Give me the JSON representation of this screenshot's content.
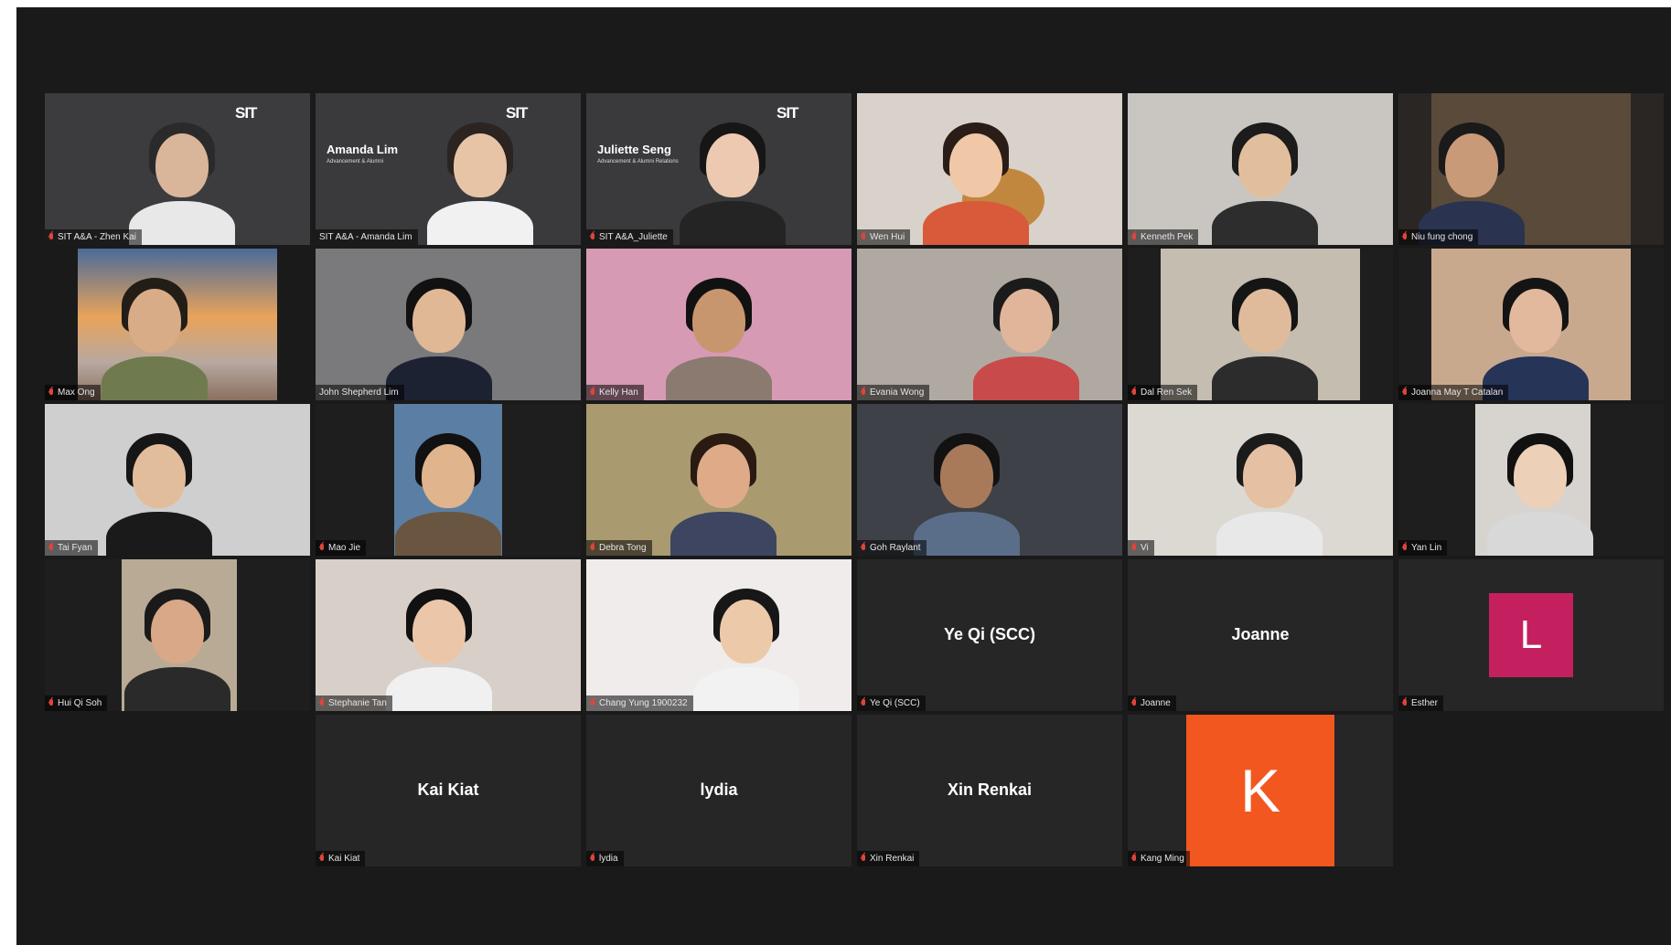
{
  "meeting": {
    "colors": {
      "background": "#1a1a1a",
      "tile": "#262626",
      "active_border": "#c9d25a",
      "muted_icon": "#e0443b"
    },
    "tiles": [
      {
        "name": "SIT A&A - Zhen Kai",
        "muted": true,
        "active": false,
        "type": "video"
      },
      {
        "name": "SIT A&A - Amanda Lim",
        "muted": false,
        "active": true,
        "type": "video",
        "banner_name": "Amanda Lim",
        "banner_sub": "Advancement & Alumni"
      },
      {
        "name": "SIT A&A_Juliette",
        "muted": true,
        "active": false,
        "type": "video",
        "banner_name": "Juliette Seng",
        "banner_sub": "Advancement & Alumni Relations"
      },
      {
        "name": "Wen Hui",
        "muted": true,
        "active": false,
        "type": "video"
      },
      {
        "name": "Kenneth Pek",
        "muted": true,
        "active": false,
        "type": "video"
      },
      {
        "name": "Niu fung chong",
        "muted": true,
        "active": false,
        "type": "video"
      },
      {
        "name": "Max Ong",
        "muted": true,
        "active": false,
        "type": "video"
      },
      {
        "name": "John Shepherd Lim",
        "muted": false,
        "active": false,
        "type": "video"
      },
      {
        "name": "Kelly Han",
        "muted": true,
        "active": false,
        "type": "video"
      },
      {
        "name": "Evania Wong",
        "muted": true,
        "active": false,
        "type": "video"
      },
      {
        "name": "Dal Ren Sek",
        "muted": true,
        "active": false,
        "type": "video"
      },
      {
        "name": "Joanna May T Catalan",
        "muted": true,
        "active": false,
        "type": "video"
      },
      {
        "name": "Tai Fyan",
        "muted": true,
        "active": false,
        "type": "video"
      },
      {
        "name": "Mao Jie",
        "muted": true,
        "active": false,
        "type": "video"
      },
      {
        "name": "Debra Tong",
        "muted": true,
        "active": false,
        "type": "video"
      },
      {
        "name": "Goh Raylant",
        "muted": true,
        "active": false,
        "type": "video"
      },
      {
        "name": "Vi",
        "muted": true,
        "active": false,
        "type": "video"
      },
      {
        "name": "Yan Lin",
        "muted": true,
        "active": false,
        "type": "video"
      },
      {
        "name": "Hui Qi Soh",
        "muted": true,
        "active": false,
        "type": "video"
      },
      {
        "name": "Stephanie Tan",
        "muted": true,
        "active": false,
        "type": "video"
      },
      {
        "name": "Chang Yung 1900232",
        "muted": true,
        "active": false,
        "type": "video"
      },
      {
        "name": "Ye Qi (SCC)",
        "muted": true,
        "active": false,
        "type": "name",
        "display": "Ye Qi (SCC)"
      },
      {
        "name": "Joanne",
        "muted": true,
        "active": false,
        "type": "name",
        "display": "Joanne"
      },
      {
        "name": "Esther",
        "muted": true,
        "active": false,
        "type": "avatar",
        "initial": "L",
        "avatar_color": "#c4205f"
      },
      {
        "name": "Kai Kiat",
        "muted": true,
        "active": false,
        "type": "name",
        "display": "Kai Kiat"
      },
      {
        "name": "lydia",
        "muted": true,
        "active": false,
        "type": "name",
        "display": "lydia"
      },
      {
        "name": "Xin Renkai",
        "muted": true,
        "active": false,
        "type": "name",
        "display": "Xin Renkai"
      },
      {
        "name": "Kang Ming",
        "muted": true,
        "active": false,
        "type": "avatar",
        "initial": "K",
        "avatar_color": "#f2571f"
      }
    ]
  }
}
